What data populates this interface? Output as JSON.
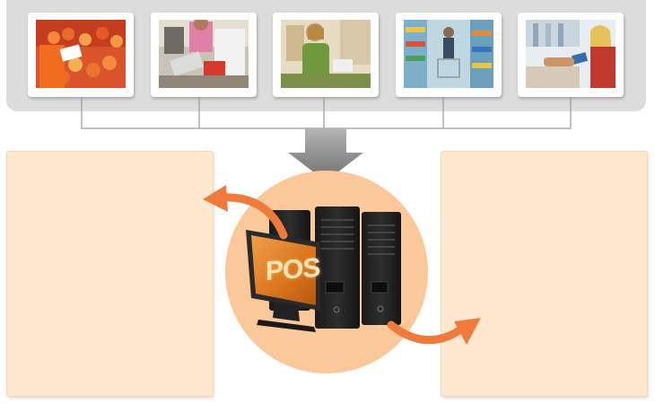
{
  "thumbnails": [
    {
      "name": "produce-market-photo"
    },
    {
      "name": "checkout-counter-photo"
    },
    {
      "name": "shop-clerk-photo"
    },
    {
      "name": "supermarket-aisle-photo"
    },
    {
      "name": "card-payment-photo"
    }
  ],
  "pos_terminal": {
    "screen_text": "POS"
  },
  "colors": {
    "strip": "#dcdcdc",
    "panel": "#fde8cf",
    "circle": "#fbc89a",
    "arrow_orange": "#ee7b3b",
    "arrow_gray": "#8a8a8a",
    "connector": "#9a9a9a"
  }
}
